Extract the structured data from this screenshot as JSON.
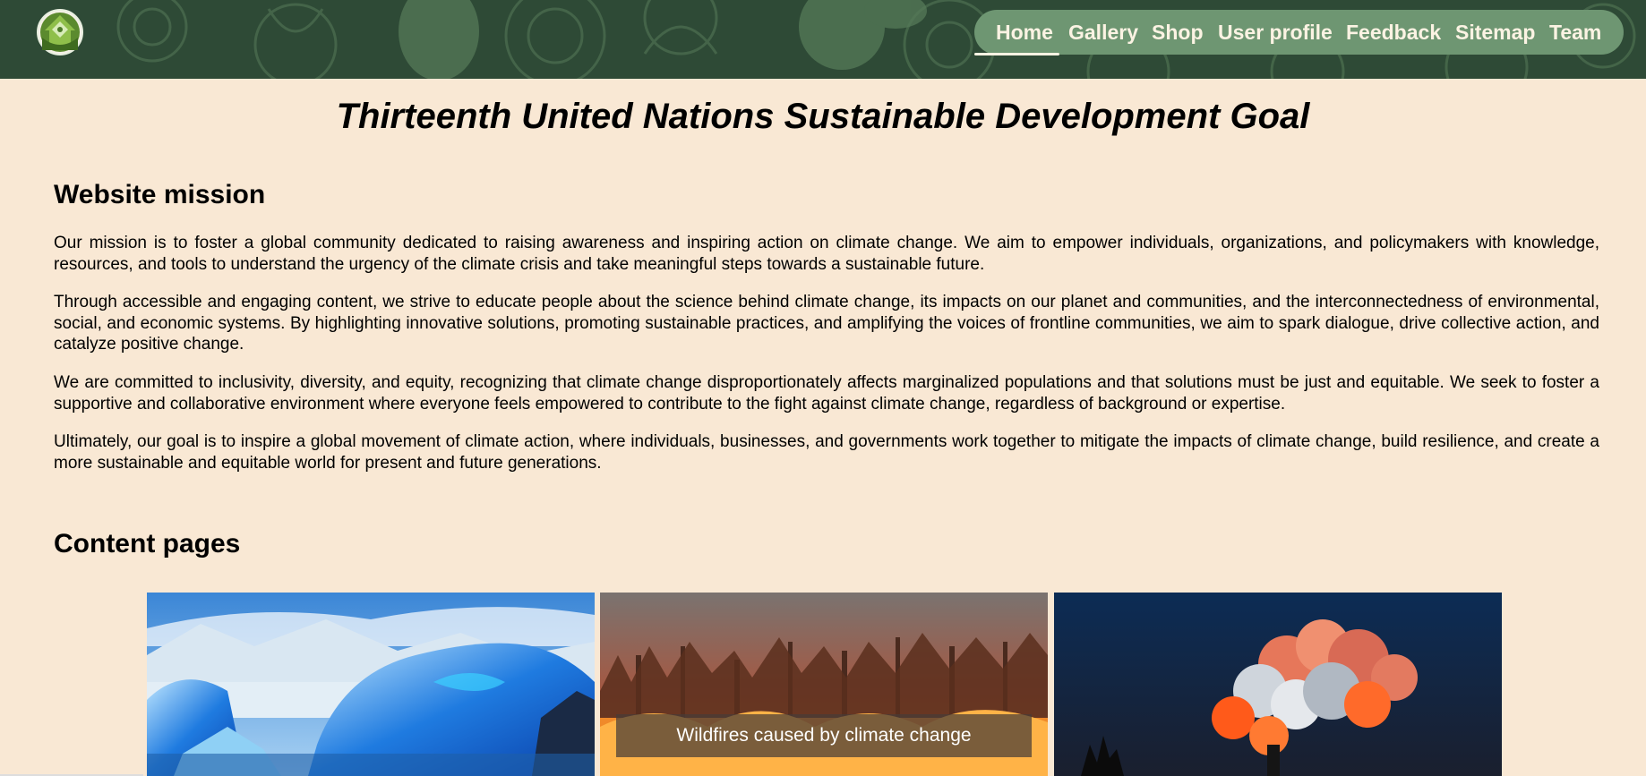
{
  "header": {
    "logo_icon": "home-leaf-logo-icon",
    "nav": [
      {
        "label": "Home",
        "active": true
      },
      {
        "label": "Gallery"
      },
      {
        "label": "Shop"
      },
      {
        "label": "User profile"
      },
      {
        "label": "Feedback"
      },
      {
        "label": "Sitemap"
      },
      {
        "label": "Team"
      }
    ]
  },
  "main": {
    "title": "Thirteenth United Nations Sustainable Development Goal",
    "mission": {
      "heading": "Website mission",
      "paragraphs": [
        "Our mission is to foster a global community dedicated to raising awareness and inspiring action on climate change. We aim to empower individuals, organizations, and policymakers with knowledge, resources, and tools to understand the urgency of the climate crisis and take meaningful steps towards a sustainable future.",
        "Through accessible and engaging content, we strive to educate people about the science behind climate change, its impacts on our planet and communities, and the interconnectedness of environmental, social, and economic systems. By highlighting innovative solutions, promoting sustainable practices, and amplifying the voices of frontline communities, we aim to spark dialogue, drive collective action, and catalyze positive change.",
        "We are committed to inclusivity, diversity, and equity, recognizing that climate change disproportionately affects marginalized populations and that solutions must be just and equitable. We seek to foster a supportive and collaborative environment where everyone feels empowered to contribute to the fight against climate change, regardless of background or expertise.",
        "Ultimately, our goal is to inspire a global movement of climate action, where individuals, businesses, and governments work together to mitigate the impacts of climate change, build resilience, and create a more sustainable and equitable world for present and future generations."
      ]
    },
    "content": {
      "heading": "Content pages",
      "cards": [
        {
          "image": "melting-glacier-photo",
          "caption": ""
        },
        {
          "image": "forest-wildfire-photo",
          "caption": "Wildfires caused by climate change"
        },
        {
          "image": "smokestack-pollution-photo",
          "caption": ""
        }
      ]
    }
  },
  "colors": {
    "background": "#f9e8d4",
    "header": "#2e4a36",
    "nav_pill": "#6e9672",
    "nav_text": "#fbf3e3"
  }
}
